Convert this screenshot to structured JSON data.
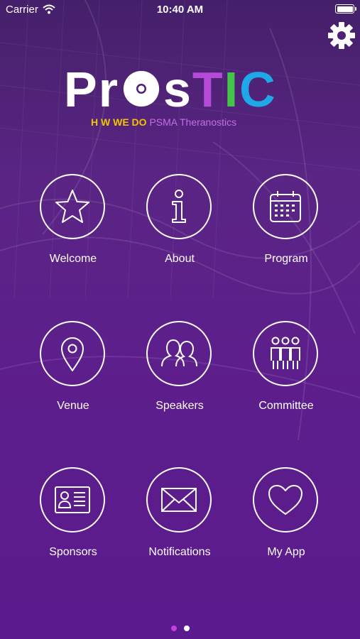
{
  "status_bar": {
    "carrier": "Carrier",
    "time": "10:40 AM",
    "battery_level": 1.0
  },
  "logo": {
    "parts": [
      "Pr",
      "s",
      "T",
      "I",
      "C"
    ],
    "tagline_a": "H W WE DO",
    "tagline_b": "PSMA Theranostics"
  },
  "menu": [
    {
      "label": "Welcome",
      "icon": "star-icon"
    },
    {
      "label": "About",
      "icon": "info-icon"
    },
    {
      "label": "Program",
      "icon": "calendar-icon"
    },
    {
      "label": "Venue",
      "icon": "map-pin-icon"
    },
    {
      "label": "Speakers",
      "icon": "speakers-icon"
    },
    {
      "label": "Committee",
      "icon": "committee-icon"
    },
    {
      "label": "Sponsors",
      "icon": "id-card-icon"
    },
    {
      "label": "Notifications",
      "icon": "envelope-icon"
    },
    {
      "label": "My App",
      "icon": "heart-icon"
    }
  ],
  "pager": {
    "pages": 2,
    "current": 1
  },
  "colors": {
    "active_dot": "#c040e0",
    "inactive_dot": "#ffffff",
    "tagline_gold": "#f2c400",
    "tagline_purple": "#c46be8",
    "logo_t": "#b54ad8",
    "logo_i": "#44c34a",
    "logo_c": "#1fa8e8"
  }
}
